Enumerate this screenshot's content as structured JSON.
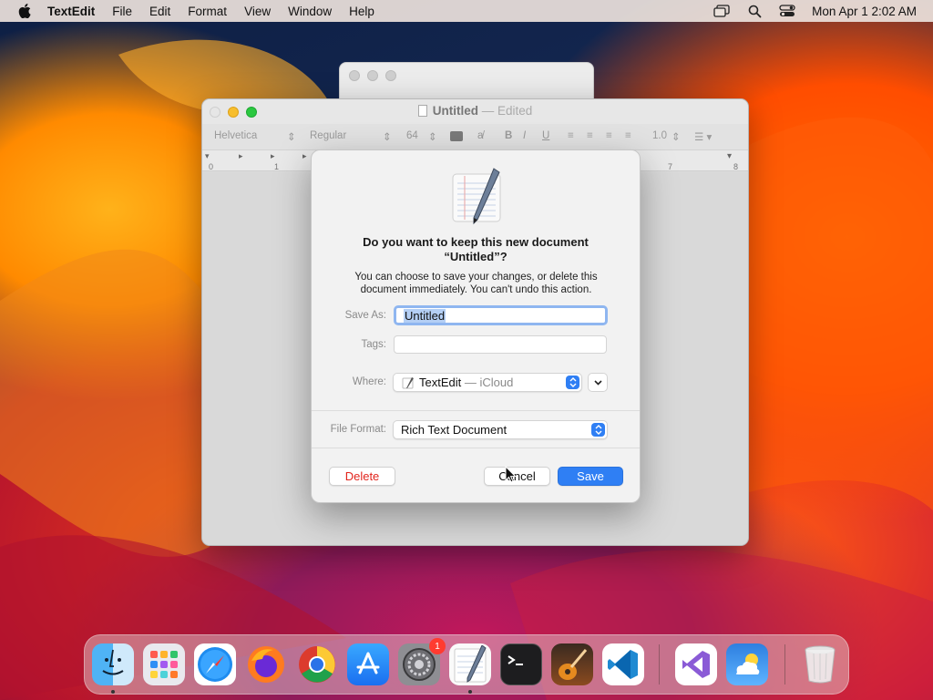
{
  "menubar": {
    "app_name": "TextEdit",
    "items": [
      "File",
      "Edit",
      "Format",
      "View",
      "Window",
      "Help"
    ],
    "clock": "Mon Apr 1  2:02 AM"
  },
  "window": {
    "title": "Untitled",
    "title_suffix": "— Edited",
    "toolbar": {
      "font_family": "Helvetica",
      "font_style": "Regular",
      "font_size": "64",
      "bold": "B",
      "italic": "I",
      "underline": "U",
      "line_spacing": "1.0"
    },
    "ruler": {
      "marks": [
        "0",
        "1",
        "7",
        "8"
      ]
    }
  },
  "dialog": {
    "title": "Do you want to keep this new document “Untitled”?",
    "message": "You can choose to save your changes, or delete this document immediately. You can't undo this action.",
    "save_as_label": "Save As:",
    "save_as_value": "Untitled",
    "tags_label": "Tags:",
    "where_label": "Where:",
    "where_value": "TextEdit",
    "where_suffix": "— iCloud",
    "file_format_label": "File Format:",
    "file_format_value": "Rich Text Document",
    "delete_label": "Delete",
    "cancel_label": "Cancel",
    "save_label": "Save"
  },
  "dock": {
    "apps": [
      "Finder",
      "Launchpad",
      "Safari",
      "Firefox",
      "Chrome",
      "App Store",
      "System Settings",
      "TextEdit",
      "Terminal",
      "GarageBand",
      "Visual Studio Code",
      "Visual Studio",
      "Weather",
      "Trash"
    ],
    "settings_badge": "1"
  },
  "colors": {
    "accent": "#2f7ff4",
    "delete_red": "#e2241c",
    "badge_red": "#ff3b30"
  }
}
